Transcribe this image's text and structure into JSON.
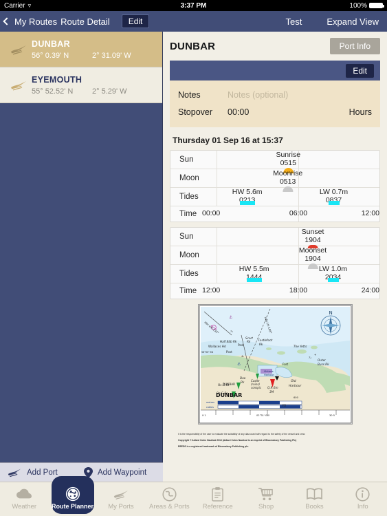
{
  "status_bar": {
    "carrier": "Carrier",
    "wifi_icon": "wifi-icon",
    "time": "3:37 PM",
    "battery_percent": "100%"
  },
  "nav_bar": {
    "back_label": "My Routes",
    "title": "Route Detail",
    "edit_label": "Edit",
    "test_label": "Test",
    "expand_label": "Expand View"
  },
  "sidebar": {
    "routes": [
      {
        "name": "DUNBAR",
        "lat": "56° 0.39' N",
        "lon": "2° 31.09' W",
        "selected": true
      },
      {
        "name": "EYEMOUTH",
        "lat": "55° 52.52' N",
        "lon": "2° 5.29' W",
        "selected": false
      }
    ],
    "add_port_label": "Add Port",
    "add_waypoint_label": "Add Waypoint"
  },
  "detail": {
    "port_title": "DUNBAR",
    "port_info_label": "Port Info",
    "edit_label": "Edit",
    "notes_label": "Notes",
    "notes_placeholder": "Notes (optional)",
    "stopover_label": "Stopover",
    "stopover_value": "00:00",
    "stopover_unit": "Hours",
    "date_header": "Thursday 01 Sep 16 at 15:37"
  },
  "tide_tables": [
    {
      "row_labels": {
        "sun": "Sun",
        "moon": "Moon",
        "tides": "Tides",
        "time": "Time"
      },
      "axis_ticks": [
        "00:00",
        "06:00",
        "12:00"
      ],
      "axis_start_hour": 0,
      "axis_end_hour": 12,
      "sun_events": [
        {
          "label": "Sunrise",
          "time": "0515",
          "hour": 5.25,
          "kind": "rise"
        }
      ],
      "moon_events": [
        {
          "label": "Moonrise",
          "time": "0513",
          "hour": 5.22,
          "kind": "rise"
        }
      ],
      "tide_events": [
        {
          "label": "HW 5.6m",
          "time": "0213",
          "hour": 2.22,
          "kind": "high"
        },
        {
          "label": "LW 0.7m",
          "time": "0837",
          "hour": 8.62,
          "kind": "low"
        }
      ]
    },
    {
      "row_labels": {
        "sun": "Sun",
        "moon": "Moon",
        "tides": "Tides",
        "time": "Time"
      },
      "axis_ticks": [
        "12:00",
        "18:00",
        "24:00"
      ],
      "axis_start_hour": 12,
      "axis_end_hour": 24,
      "sun_events": [
        {
          "label": "Sunset",
          "time": "1904",
          "hour": 19.07,
          "kind": "set"
        }
      ],
      "moon_events": [
        {
          "label": "Moonset",
          "time": "1904",
          "hour": 19.07,
          "kind": "set"
        }
      ],
      "tide_events": [
        {
          "label": "HW 5.5m",
          "time": "1444",
          "hour": 14.73,
          "kind": "high"
        },
        {
          "label": "LW 1.0m",
          "time": "2034",
          "hour": 20.57,
          "kind": "low"
        }
      ]
    }
  ],
  "chart": {
    "place_label": "DUNBAR",
    "compass_label": "N",
    "labels": [
      "Hbr ent 132°",
      "Ldg Lts 198°",
      "Half Ebb Rk",
      "Wallaces Hd",
      "Post",
      "Post",
      "Scart Rk",
      "Castlefoot Rk",
      "The Yetts",
      "Outer Buss Rk",
      "Fort",
      "Victoria Harbour",
      "Doo Rk",
      "Castle (ruins) conspic",
      "Old Harbour",
      "Q.R.6m 3M",
      "Oc.G.6s",
      "Oc.G.6s",
      "FS",
      "56°00'·5N",
      "02°31'·0W",
      "metres",
      "cables",
      "0·1",
      "600",
      "30·5"
    ]
  },
  "legal": {
    "line1": "It is the responsibility of the user to evaluate the suitability of any data used with regard to the safety of the vessel and crew.",
    "line2": "Copyright © Adlard Coles Nautical 2016 (Adlard Coles Nautical is an imprint of Bloomsbury Publishing Plc)",
    "line3": "REEDS is a registered trademark of Bloomsbury Publishing plc."
  },
  "tab_bar": {
    "tabs": [
      {
        "label": "Weather",
        "icon": "cloud-icon",
        "active": false
      },
      {
        "label": "Route Planner",
        "icon": "compass-route-icon",
        "active": true
      },
      {
        "label": "My Ports",
        "icon": "port-icon",
        "active": false
      },
      {
        "label": "Areas & Ports",
        "icon": "globe-icon",
        "active": false
      },
      {
        "label": "Reference",
        "icon": "clipboard-icon",
        "active": false
      },
      {
        "label": "Shop",
        "icon": "cart-icon",
        "active": false
      },
      {
        "label": "Books",
        "icon": "book-icon",
        "active": false
      },
      {
        "label": "Info",
        "icon": "info-icon",
        "active": false
      }
    ]
  },
  "colors": {
    "navy": "#414d77",
    "navy_dark": "#24305c",
    "tan_selected": "#d4bd88",
    "cream": "#f2efe6",
    "notes_tan": "#f0e3c8",
    "cyan_tide": "#19e6f5",
    "sunrise_orange": "#f5ad18",
    "sunset_red": "#e03b2b",
    "grey_button": "#a9a59b"
  }
}
